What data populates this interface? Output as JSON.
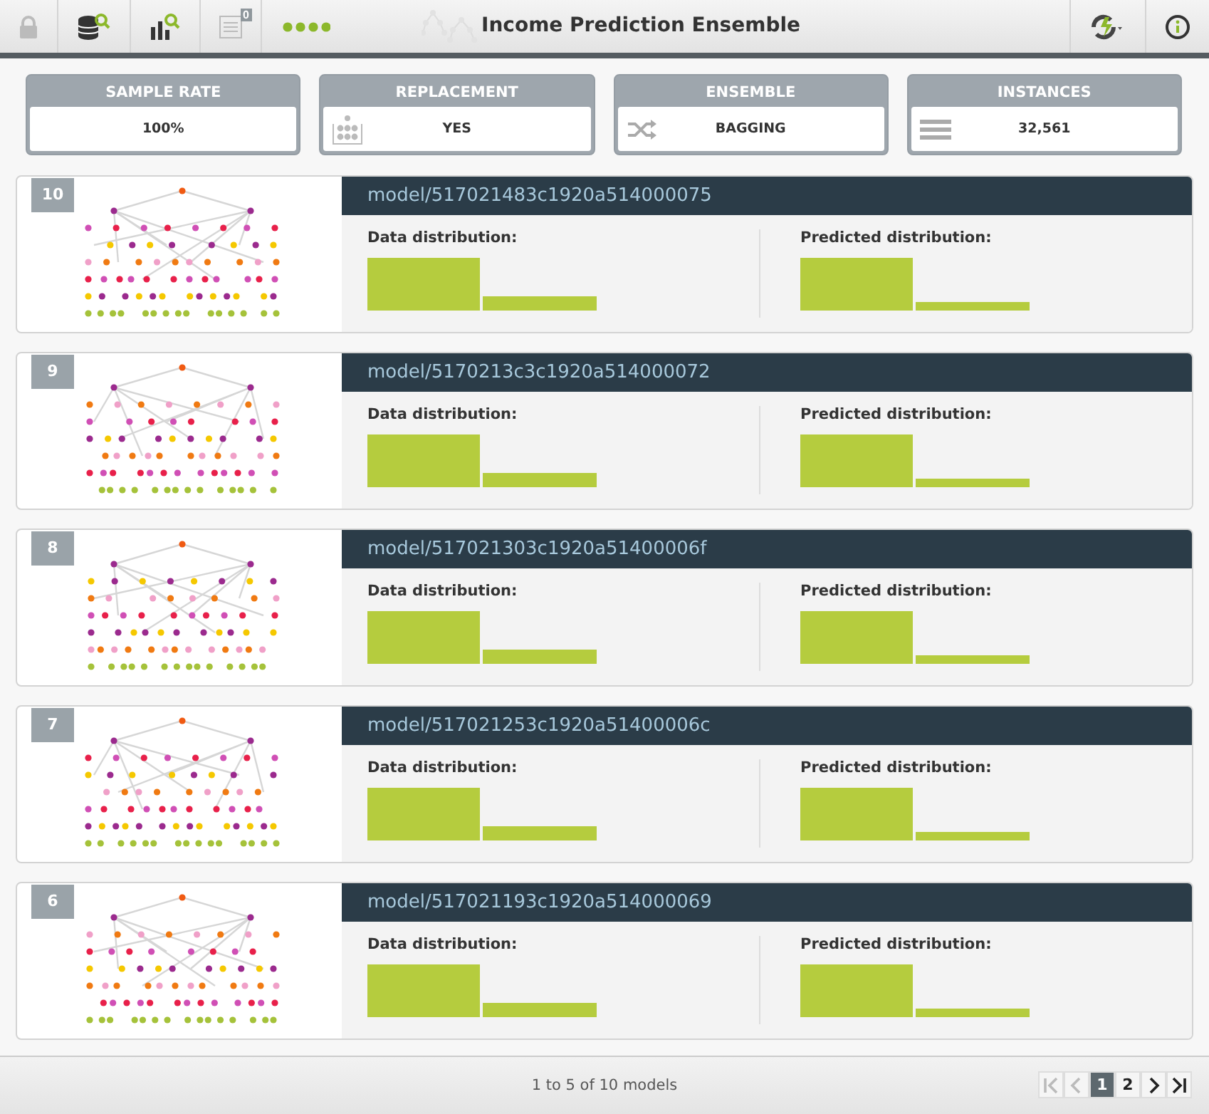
{
  "toolbar": {
    "title": "Income Prediction Ensemble",
    "badge": "0"
  },
  "stats": [
    {
      "label": "SAMPLE RATE",
      "value": "100%",
      "kind": "plain"
    },
    {
      "label": "REPLACEMENT",
      "value": "YES",
      "kind": "replacement"
    },
    {
      "label": "ENSEMBLE",
      "value": "BAGGING",
      "kind": "shuffle"
    },
    {
      "label": "INSTANCES",
      "value": "32,561",
      "kind": "rows"
    }
  ],
  "models": [
    {
      "number": "10",
      "id": "model/517021483c1920a514000075",
      "data_label": "Data distribution:",
      "predicted_label": "Predicted distribution:"
    },
    {
      "number": "9",
      "id": "model/5170213c3c1920a514000072",
      "data_label": "Data distribution:",
      "predicted_label": "Predicted distribution:"
    },
    {
      "number": "8",
      "id": "model/517021303c1920a51400006f",
      "data_label": "Data distribution:",
      "predicted_label": "Predicted distribution:"
    },
    {
      "number": "7",
      "id": "model/517021253c1920a51400006c",
      "data_label": "Data distribution:",
      "predicted_label": "Predicted distribution:"
    },
    {
      "number": "6",
      "id": "model/517021193c1920a514000069",
      "data_label": "Data distribution:",
      "predicted_label": "Predicted distribution:"
    }
  ],
  "footer": {
    "summary": "1 to 5 of 10 models",
    "nav": [
      {
        "kind": "first",
        "disabled": true
      },
      {
        "kind": "prev",
        "disabled": true
      }
    ],
    "pages": [
      {
        "label": "1",
        "selected": true
      },
      {
        "label": "2",
        "selected": false
      }
    ],
    "nav_end": [
      {
        "kind": "next",
        "disabled": false
      },
      {
        "kind": "last",
        "disabled": false
      }
    ]
  }
}
